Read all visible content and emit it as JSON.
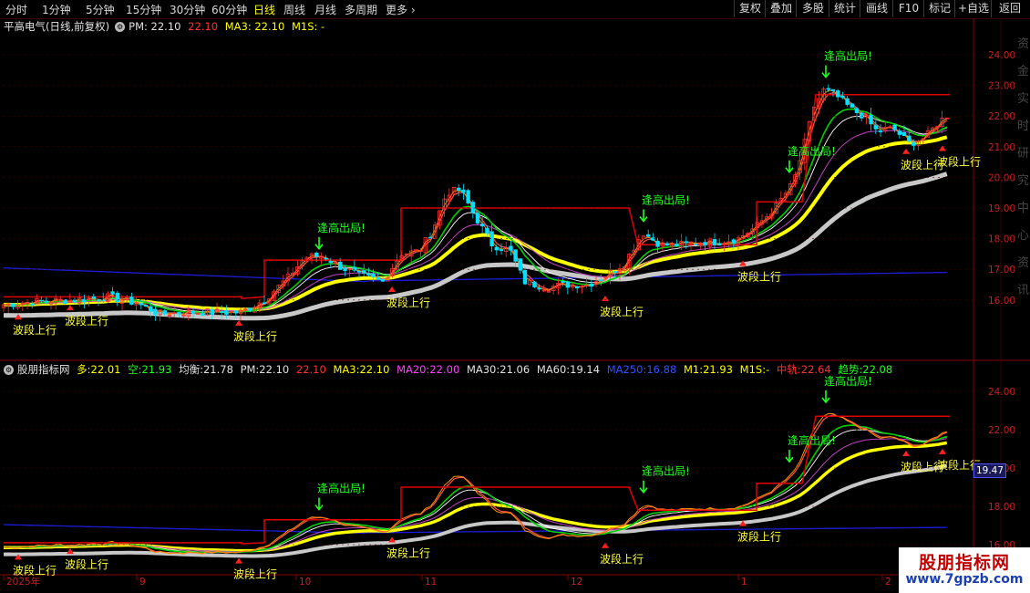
{
  "toolbar": {
    "periods": [
      "分时",
      "1分钟",
      "5分钟",
      "15分钟",
      "30分钟",
      "60分钟",
      "日线",
      "周线",
      "月线",
      "多周期",
      "更多"
    ],
    "active_period": "日线",
    "buttons": [
      "复权",
      "叠加",
      "多股",
      "统计",
      "画线",
      "F10",
      "标记",
      "+自选",
      "返回"
    ]
  },
  "main_header": {
    "stock_name": "平高电气(日线,前复权)",
    "pm_label": "PM:",
    "pm_value": "22.10",
    "pm_value2": "22.10",
    "ma3_label": "MA3:",
    "ma3_value": "22.10",
    "m1s_label": "M1S:",
    "m1s_value": "-"
  },
  "sub_header": {
    "indicator_name": "股朋指标网",
    "duo_label": "多:",
    "duo_value": "22.01",
    "kong_label": "空:",
    "kong_value": "21.93",
    "junheng_label": "均衡:",
    "junheng_value": "21.78",
    "pm_label": "PM:",
    "pm_value": "22.10",
    "pm_value2": "22.10",
    "ma3_label": "MA3:",
    "ma3_value": "22.10",
    "ma20_label": "MA20:",
    "ma20_value": "22.00",
    "ma30_label": "MA30:",
    "ma30_value": "21.06",
    "ma60_label": "MA60:",
    "ma60_value": "19.14",
    "ma250_label": "MA250:",
    "ma250_value": "16.88",
    "m1_label": "M1:",
    "m1_value": "21.93",
    "m1s_label": "M1S:",
    "m1s_value": "-",
    "zhonggui_label": "中轨:",
    "zhonggui_value": "22.64",
    "qushi_label": "趋势:",
    "qushi_value": "22.08"
  },
  "main_axis": [
    "24.00",
    "23.00",
    "22.00",
    "21.00",
    "20.00",
    "19.00",
    "18.00",
    "17.00",
    "16.00"
  ],
  "sub_axis": [
    "24.00",
    "22.00",
    "20.00",
    "18.00",
    "16.00"
  ],
  "sub_price_label": "19.47",
  "date_axis": [
    "2025年",
    "9",
    "10",
    "11",
    "12",
    "1",
    "2"
  ],
  "signals": {
    "exit_label": "逢高出局!",
    "up_label": "波段上行"
  },
  "right_strip_text": "资金实时研究中心资讯",
  "logo": {
    "line1": "股朋指标网",
    "line2": "www.7gpzb.com"
  },
  "colors": {
    "up": "#ff3030",
    "down": "#00e0ff",
    "ma_yellow": "#ffff00",
    "ma_gray": "#c8c8c8",
    "ma_green": "#00d000",
    "ma_red": "#e00000",
    "ma_blue": "#1c1cd8",
    "ma_purple": "#c040c0",
    "signal_green": "#20ff20",
    "signal_yellow": "#ffff40"
  }
}
